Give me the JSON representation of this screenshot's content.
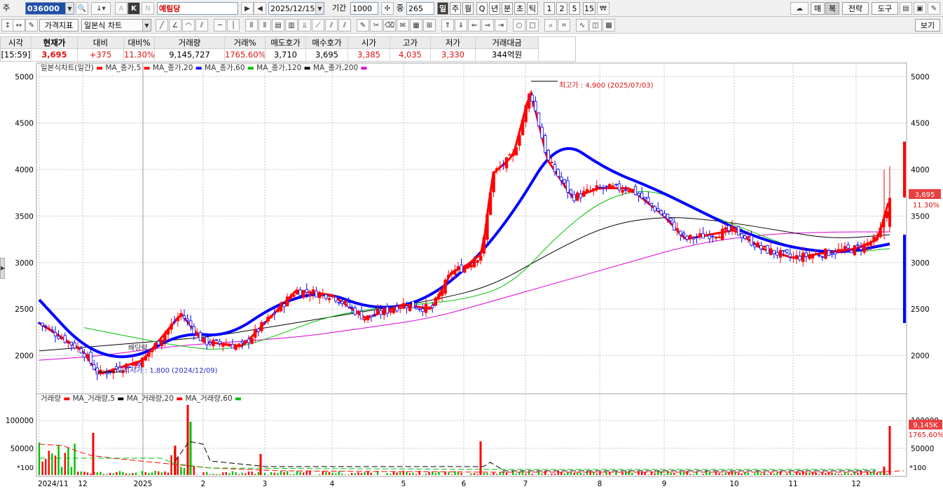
{
  "toolbar1": {
    "stock_label": "주",
    "code": "036000",
    "name": "예림당",
    "date": "2025/12/15",
    "period_label": "기간",
    "period": "1000",
    "count_label": "중",
    "count": "265",
    "k_label": "K",
    "n_label": "N",
    "a_label": "A",
    "period_buttons": [
      "일",
      "주",
      "월",
      "Q",
      "년",
      "분",
      "초",
      "틱",
      "1",
      "2",
      "5",
      "15"
    ],
    "right_buttons": [
      "매",
      "복",
      "전략",
      "도구"
    ]
  },
  "toolbar2": {
    "price_label": "가격지표",
    "chart_type": "일본식 차트",
    "view_label": "보기"
  },
  "quote": {
    "headers": [
      "시각",
      "현재가",
      "대비",
      "대비%",
      "거래량",
      "거래%",
      "매도호가",
      "매수호가",
      "시가",
      "고가",
      "저가",
      "거래대금"
    ],
    "values": [
      "[15:59]",
      "3,695",
      "+375",
      "11.30%",
      "9,145,727",
      "1765.60%",
      "3,710",
      "3,695",
      "3,385",
      "4,035",
      "3,330",
      "344억원"
    ]
  },
  "price_panel": {
    "legend": [
      "일본식차트(일간)",
      "MA_종가,5",
      "MA_종가,20",
      "MA_종가,60",
      "MA_종가,120",
      "MA_종가,200"
    ],
    "high_note": "최고가 : 4,900 (2025/07/03)",
    "low_note": "최저가 : 1,800 (2024/12/09)",
    "low_prefix": "최저",
    "marker_note": "배당락",
    "price_tag": "3,695",
    "pct_tag": "11.30%",
    "y_ticks": [
      "5000",
      "4500",
      "4000",
      "3500",
      "3000",
      "2500",
      "2000"
    ]
  },
  "volume_panel": {
    "legend": [
      "거래량",
      "MA_거래량,5",
      "MA_거래량,20",
      "MA_거래량,60"
    ],
    "vol_tag": "9,145K",
    "pct_tag": "1765.60%",
    "y_ticks": [
      "100000",
      "50000"
    ],
    "unit": "*100"
  },
  "x_labels": [
    "2024/11",
    "12",
    "2025",
    "2",
    "3",
    "4",
    "5",
    "6",
    "7",
    "8",
    "9",
    "10",
    "11",
    "12"
  ],
  "colors": {
    "up": "#ff0000",
    "down": "#0000ff",
    "ma5": "#ff0000",
    "ma20": "#0000ff",
    "ma60": "#00c000",
    "ma120": "#000000",
    "ma200": "#dd00dd"
  },
  "chart_data": {
    "type": "candlestick",
    "ylim": [
      1650,
      5100
    ],
    "y_ticks": [
      2000,
      2500,
      3000,
      3500,
      4000,
      4500,
      5000
    ],
    "max": {
      "value": 4900,
      "date": "2025/07/03"
    },
    "min": {
      "value": 1800,
      "date": "2024/12/09"
    },
    "last": {
      "close": 3695,
      "open": 3385,
      "high": 4035,
      "low": 3330,
      "volume": 9145727
    },
    "close_path": [
      [
        "2024/11",
        2350
      ],
      [
        "2024/12",
        2050
      ],
      [
        "2024/12/09",
        1800
      ],
      [
        "2025/01",
        1950
      ],
      [
        "2025/01/20",
        2450
      ],
      [
        "2025/02",
        2150
      ],
      [
        "2025/02/20",
        2100
      ],
      [
        "2025/03",
        2350
      ],
      [
        "2025/03/15",
        2700
      ],
      [
        "2025/04",
        2650
      ],
      [
        "2025/04/15",
        2400
      ],
      [
        "2025/05",
        2550
      ],
      [
        "2025/05/15",
        2500
      ],
      [
        "2025/05/25",
        2900
      ],
      [
        "2025/06",
        2950
      ],
      [
        "2025/06/10",
        3100
      ],
      [
        "2025/06/15",
        3950
      ],
      [
        "2025/06/25",
        4150
      ],
      [
        "2025/07/03",
        4850
      ],
      [
        "2025/07/10",
        4100
      ],
      [
        "2025/07/20",
        3700
      ],
      [
        "2025/08",
        3800
      ],
      [
        "2025/08/15",
        3800
      ],
      [
        "2025/09",
        3500
      ],
      [
        "2025/09/10",
        3250
      ],
      [
        "2025/10",
        3350
      ],
      [
        "2025/10/15",
        3150
      ],
      [
        "2025/11",
        3050
      ],
      [
        "2025/11/15",
        3100
      ],
      [
        "2025/12",
        3150
      ],
      [
        "2025/12/10",
        3250
      ],
      [
        "2025/12/15",
        3695
      ]
    ],
    "ma": [
      {
        "name": "MA_종가,20",
        "values": [
          2600,
          2050,
          1950,
          2250,
          2200,
          2550,
          2700,
          2500,
          2550,
          2900,
          3500,
          4350,
          4000,
          3800,
          3550,
          3300,
          3150,
          3100,
          3200
        ]
      },
      {
        "name": "MA_종가,60",
        "values": [
          2300,
          2200,
          2100,
          2050,
          2200,
          2400,
          2500,
          2550,
          2600,
          2750,
          3300,
          3700,
          3800,
          3550,
          3350,
          3150,
          3100,
          3150
        ]
      },
      {
        "name": "MA_종가,120",
        "values": [
          2050,
          2100,
          2150,
          2200,
          2300,
          2400,
          2500,
          2600,
          2750,
          3100,
          3400,
          3500,
          3450,
          3350,
          3250,
          3300
        ]
      },
      {
        "name": "MA_종가,200",
        "values": [
          1950,
          2000,
          2100,
          2150,
          2200,
          2300,
          2400,
          2600,
          2800,
          3000,
          3200,
          3300,
          3330,
          3330
        ]
      }
    ]
  }
}
